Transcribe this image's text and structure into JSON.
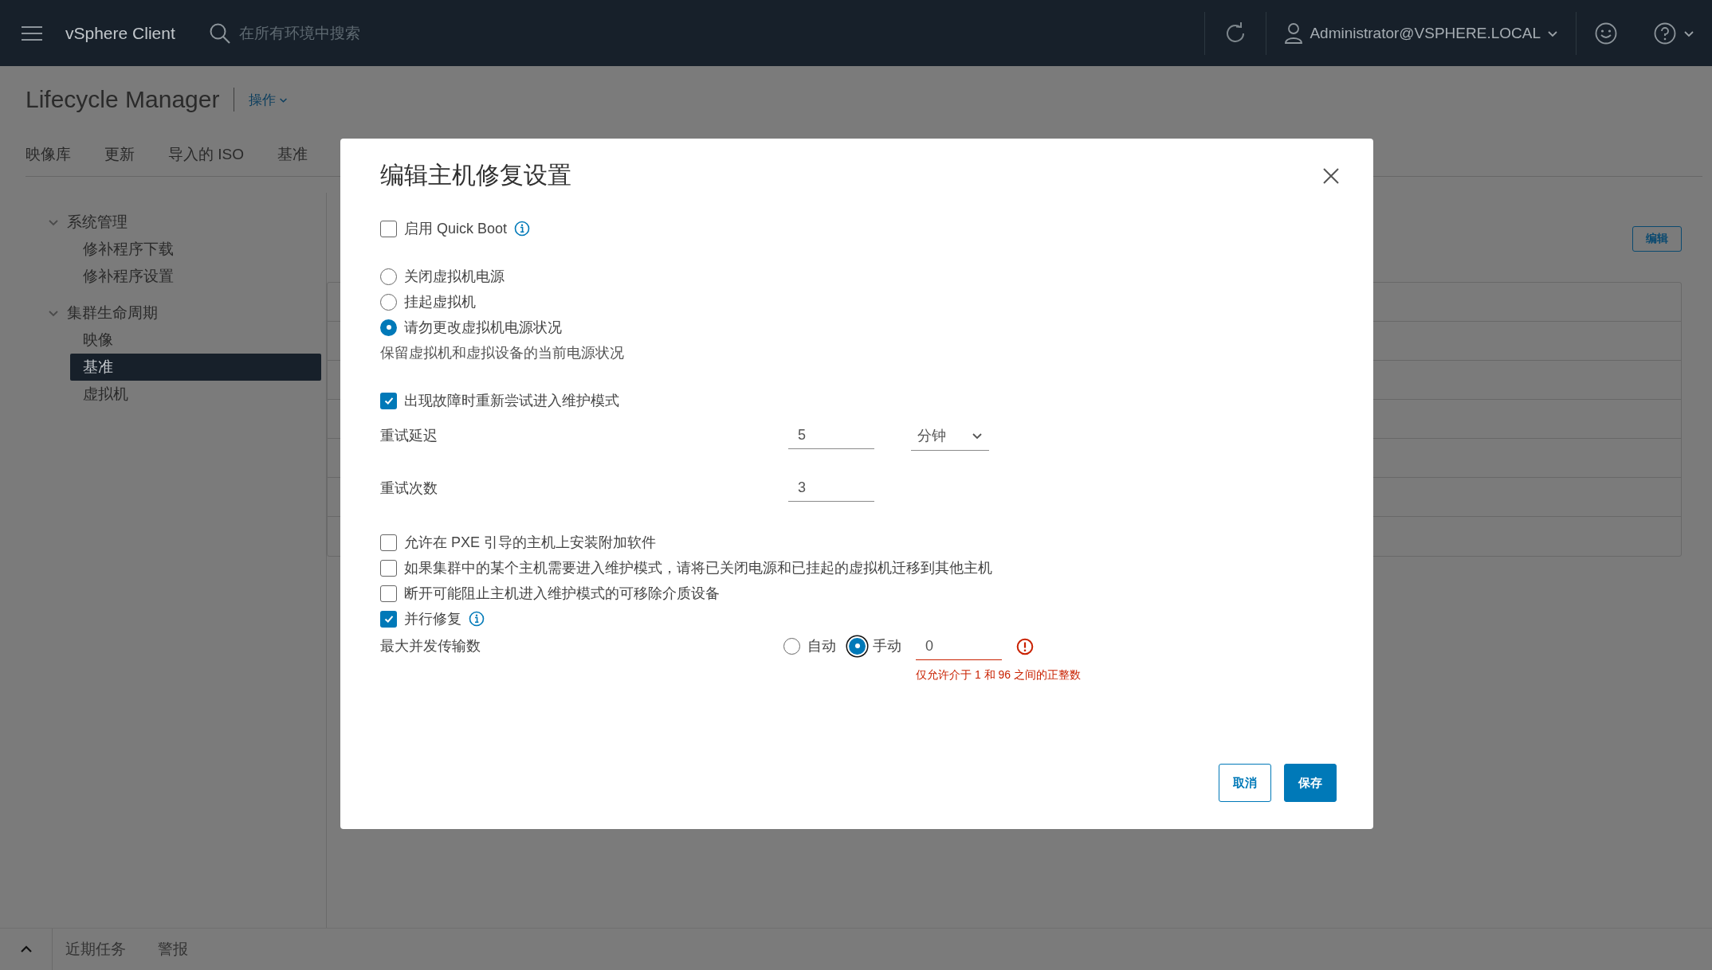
{
  "header": {
    "product": "vSphere Client",
    "search": {
      "placeholder": "在所有环境中搜索"
    },
    "user": "Administrator@VSPHERE.LOCAL"
  },
  "page": {
    "title": "Lifecycle Manager",
    "actions": "操作"
  },
  "tabs": [
    {
      "label": "映像库"
    },
    {
      "label": "更新"
    },
    {
      "label": "导入的 ISO"
    },
    {
      "label": "基准"
    }
  ],
  "sidebar": [
    {
      "label": "系统管理",
      "expanded": true,
      "children": [
        {
          "label": "修补程序下载",
          "selected": false
        },
        {
          "label": "修补程序设置",
          "selected": false
        }
      ]
    },
    {
      "label": "集群生命周期",
      "expanded": true,
      "children": [
        {
          "label": "映像",
          "selected": false
        },
        {
          "label": "基准",
          "selected": true
        },
        {
          "label": "虚拟机",
          "selected": false
        }
      ]
    }
  ],
  "edit_button": "编辑",
  "bottom_bar": {
    "tabs": [
      "近期任务",
      "警报"
    ]
  },
  "dialog": {
    "title": "编辑主机修复设置",
    "groups": [
      [
        {
          "kind": "checkbox",
          "label": "启用 Quick Boot",
          "checked": false,
          "info": true
        }
      ],
      [
        {
          "kind": "radio",
          "label": "关闭虚拟机电源",
          "selected": false
        },
        {
          "kind": "radio",
          "label": "挂起虚拟机",
          "selected": false
        },
        {
          "kind": "radio",
          "label": "请勿更改虚拟机电源状况",
          "selected": true
        },
        {
          "kind": "note",
          "text": "保留虚拟机和虚拟设备的当前电源状况"
        }
      ],
      [
        {
          "kind": "checkbox",
          "label": "出现故障时重新尝试进入维护模式",
          "checked": true,
          "info": false
        },
        {
          "kind": "field",
          "label": "重试延迟",
          "value": "5",
          "unit": "分钟"
        },
        {
          "kind": "field",
          "label": "重试次数",
          "value": "3"
        }
      ],
      [
        {
          "kind": "checkbox",
          "label": "允许在 PXE 引导的主机上安装附加软件",
          "checked": false,
          "info": false
        },
        {
          "kind": "checkbox",
          "label": "如果集群中的某个主机需要进入维护模式，请将已关闭电源和已挂起的虚拟机迁移到其他主机",
          "checked": false,
          "info": false
        },
        {
          "kind": "checkbox",
          "label": "断开可能阻止主机进入维护模式的可移除介质设备",
          "checked": false,
          "info": false
        },
        {
          "kind": "checkbox",
          "label": "并行修复",
          "checked": true,
          "info": true
        },
        {
          "kind": "transfer",
          "label": "最大并发传输数",
          "modes": [
            {
              "label": "自动",
              "selected": false
            },
            {
              "label": "手动",
              "selected": true
            }
          ],
          "value": "0",
          "error": "仅允许介于 1 和 96 之间的正整数"
        }
      ]
    ],
    "buttons": {
      "cancel": "取消",
      "save": "保存"
    }
  }
}
